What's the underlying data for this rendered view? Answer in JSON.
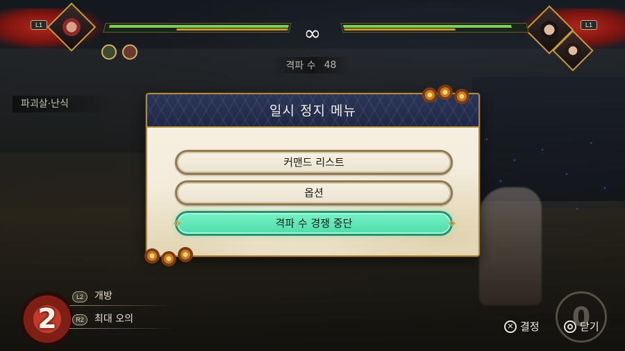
{
  "hud": {
    "p1_button": "L1",
    "p2_button": "L1",
    "timer": "∞",
    "combo_label": "격파 수",
    "combo_value": "48",
    "skill_name": "파괴살·난식",
    "health_bar_p1": 0.98,
    "health_bar_p2": 0.92
  },
  "pause_menu": {
    "title": "일시 정지 메뉴",
    "items": [
      {
        "label": "커맨드 리스트",
        "selected": false
      },
      {
        "label": "옵션",
        "selected": false
      },
      {
        "label": "격파 수 경쟁 중단",
        "selected": true
      }
    ]
  },
  "bottom_hud": {
    "gauge_value": "2",
    "skill1_button": "L2",
    "skill1_label": "개방",
    "skill2_button": "R2",
    "skill2_label": "최대 오의",
    "gauge_right_value": "0",
    "prompts": {
      "confirm_icon": "cross-button-icon",
      "confirm_label": "결정",
      "close_icon": "circle-button-icon",
      "close_label": "닫기"
    }
  },
  "colors": {
    "selected_button": "#5fe8b8",
    "dialog_header": "#25304f",
    "gold_border": "#b08a3c"
  }
}
